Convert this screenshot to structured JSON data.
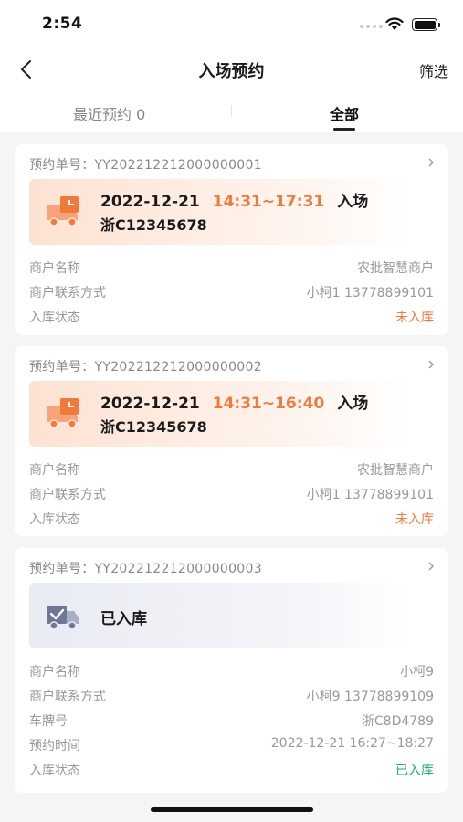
{
  "status_bar": {
    "time": "2:54"
  },
  "nav": {
    "title": "入场预约",
    "filter_label": "筛选"
  },
  "tabs": {
    "recent": "最近预约 0",
    "all": "全部"
  },
  "colors": {
    "accent_orange": "#f07a3a",
    "success_green": "#1fb26b"
  },
  "cards": [
    {
      "order_no": "预约单号：YY202212212000000001",
      "date": "2022-12-21",
      "time_range": "14:31~17:31",
      "entry_label": "入场",
      "plate": "浙C12345678",
      "rows": [
        {
          "key": "商户名称",
          "value": "农批智慧商户"
        },
        {
          "key": "商户联系方式",
          "value": "小柯1 13778899101"
        },
        {
          "key": "入库状态",
          "value": "未入库"
        }
      ]
    },
    {
      "order_no": "预约单号：YY202212212000000002",
      "date": "2022-12-21",
      "time_range": "14:31~16:40",
      "entry_label": "入场",
      "plate": "浙C12345678",
      "rows": [
        {
          "key": "商户名称",
          "value": "农批智慧商户"
        },
        {
          "key": "商户联系方式",
          "value": "小柯1 13778899101"
        },
        {
          "key": "入库状态",
          "value": "未入库"
        }
      ]
    },
    {
      "order_no": "预约单号：YY202212212000000003",
      "status_label": "已入库",
      "rows": [
        {
          "key": "商户名称",
          "value": "小柯9"
        },
        {
          "key": "商户联系方式",
          "value": "小柯9 13778899109"
        },
        {
          "key": "车牌号",
          "value": "浙C8D4789"
        },
        {
          "key": "预约时间",
          "value": "2022-12-21 16:27~18:27"
        },
        {
          "key": "入库状态",
          "value": "已入库"
        }
      ]
    }
  ]
}
